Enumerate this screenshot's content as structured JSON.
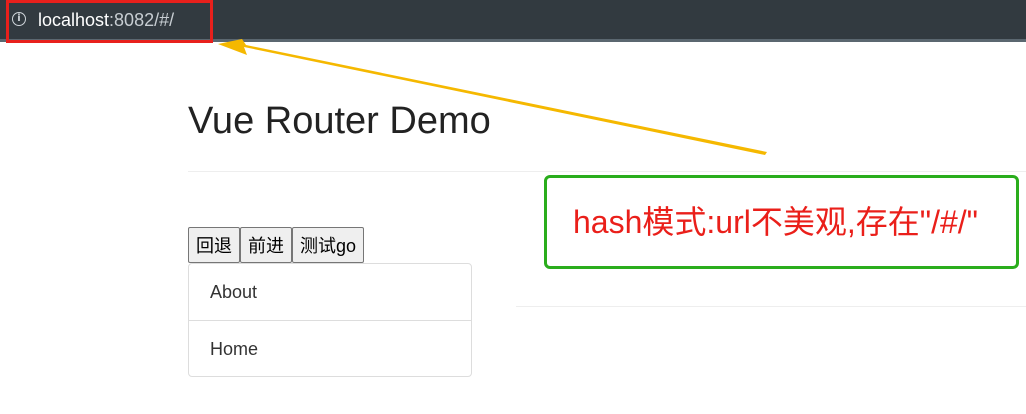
{
  "browser": {
    "url_host": "localhost",
    "url_rest": ":8082/#/",
    "info_icon": "info-icon"
  },
  "page": {
    "title": "Vue Router Demo",
    "buttons": {
      "back_label": "回退",
      "forward_label": "前进",
      "go_label": "测试go"
    },
    "nav_items": [
      {
        "label": "About"
      },
      {
        "label": "Home"
      }
    ]
  },
  "annotation": {
    "callout_text": "hash模式:url不美观,存在\"/#/\"",
    "colors": {
      "url_box": "#e8201c",
      "arrow": "#f5b800",
      "callout_border": "#2aad1c",
      "callout_text": "#ea1f1a"
    }
  }
}
